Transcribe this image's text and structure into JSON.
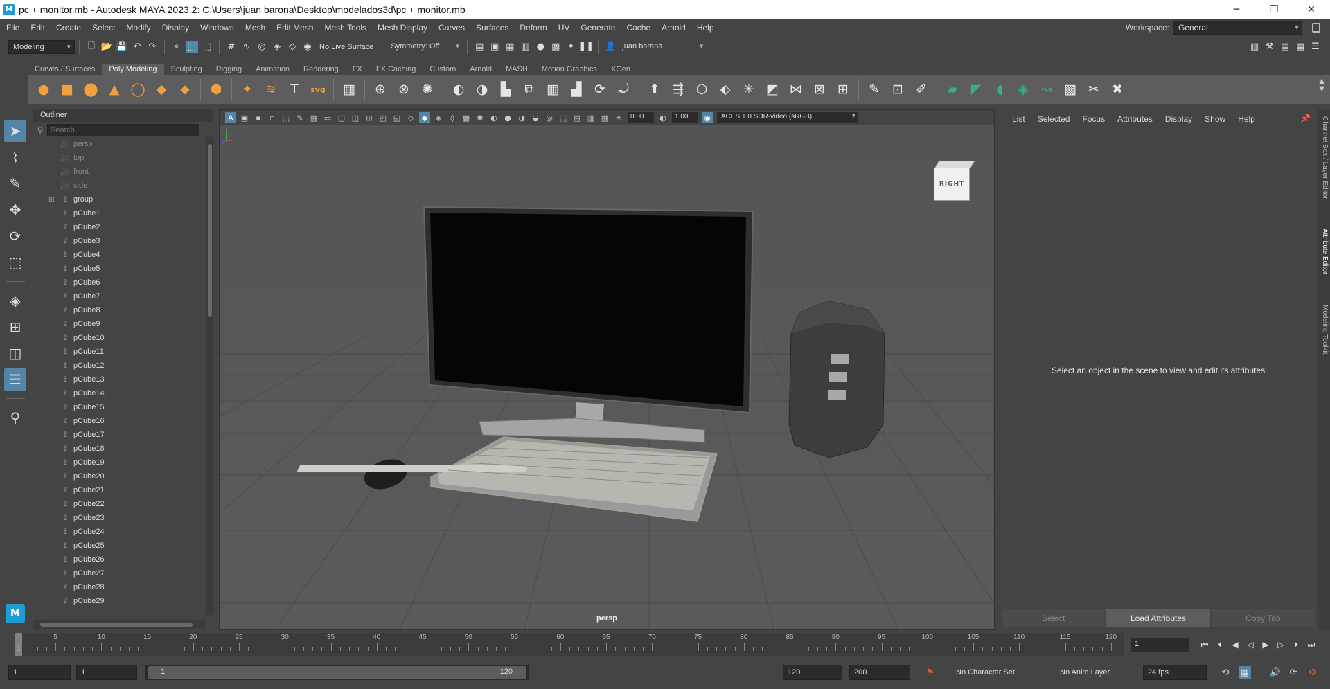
{
  "window": {
    "title": "pc + monitor.mb - Autodesk MAYA 2023.2: C:\\Users\\juan barona\\Desktop\\modelados3d\\pc + monitor.mb",
    "app_icon_letter": "M"
  },
  "menubar": {
    "items": [
      "File",
      "Edit",
      "Create",
      "Select",
      "Modify",
      "Display",
      "Windows",
      "Mesh",
      "Edit Mesh",
      "Mesh Tools",
      "Mesh Display",
      "Curves",
      "Surfaces",
      "Deform",
      "UV",
      "Generate",
      "Cache",
      "Arnold",
      "Help"
    ],
    "workspace_label": "Workspace:",
    "workspace_value": "General"
  },
  "statusline": {
    "menu_set": "Modeling",
    "live_surface": "No Live Surface",
    "symmetry": "Symmetry: Off",
    "user": "juan barana"
  },
  "shelf": {
    "tabs": [
      "Curves / Surfaces",
      "Poly Modeling",
      "Sculpting",
      "Rigging",
      "Animation",
      "Rendering",
      "FX",
      "FX Caching",
      "Custom",
      "Arnold",
      "MASH",
      "Motion Graphics",
      "XGen"
    ],
    "active_tab": "Poly Modeling"
  },
  "outliner": {
    "title": "Outliner",
    "search_placeholder": "Search...",
    "cameras": [
      "persp",
      "top",
      "front",
      "side"
    ],
    "group": "group",
    "items": [
      "pCube1",
      "pCube2",
      "pCube3",
      "pCube4",
      "pCube5",
      "pCube6",
      "pCube7",
      "pCube8",
      "pCube9",
      "pCube10",
      "pCube11",
      "pCube12",
      "pCube13",
      "pCube14",
      "pCube15",
      "pCube16",
      "pCube17",
      "pCube18",
      "pCube19",
      "pCube20",
      "pCube21",
      "pCube22",
      "pCube23",
      "pCube24",
      "pCube25",
      "pCube26",
      "pCube27",
      "pCube28",
      "pCube29"
    ]
  },
  "viewport": {
    "exposure": "0.00",
    "gamma": "1.00",
    "color_space": "ACES 1.0 SDR-video (sRGB)",
    "camera_label": "persp",
    "viewcube_label": "RIGHT"
  },
  "attribute_editor": {
    "menu": [
      "List",
      "Selected",
      "Focus",
      "Attributes",
      "Display",
      "Show",
      "Help"
    ],
    "message": "Select an object in the scene to view and edit its attributes",
    "buttons": [
      "Select",
      "Load Attributes",
      "Copy Tab"
    ],
    "side_tabs": [
      "Channel Box / Layer Editor",
      "Attribute Editor",
      "Modeling Toolkit"
    ]
  },
  "timeslider": {
    "ticks": [
      "5",
      "10",
      "15",
      "20",
      "25",
      "30",
      "35",
      "40",
      "45",
      "50",
      "55",
      "60",
      "65",
      "70",
      "75",
      "80",
      "85",
      "90",
      "95",
      "100",
      "105",
      "110",
      "115",
      "120"
    ],
    "first_tick": "1",
    "current_frame": "1"
  },
  "rangeslider": {
    "start": "1",
    "playback_start": "1",
    "range_start_label": "1",
    "range_end_label": "120",
    "playback_end": "120",
    "end": "200",
    "character_set": "No Character Set",
    "anim_layer": "No Anim Layer",
    "fps": "24 fps"
  }
}
